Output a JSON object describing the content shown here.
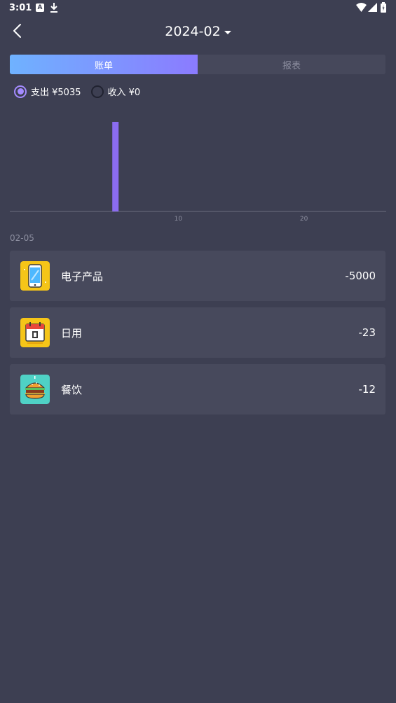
{
  "status_bar": {
    "time": "3:01",
    "a_glyph": "A"
  },
  "header": {
    "month": "2024-02"
  },
  "tabs": [
    {
      "label": "账单",
      "active": true
    },
    {
      "label": "报表",
      "active": false
    }
  ],
  "filters": {
    "expense": {
      "label": "支出 ¥5035",
      "selected": true
    },
    "income": {
      "label": "收入 ¥0",
      "selected": false
    }
  },
  "chart_data": {
    "type": "bar",
    "x_ticks": [
      10,
      20
    ],
    "x_range": [
      1,
      29
    ],
    "bars": [
      {
        "day": 5,
        "value": 5035
      }
    ],
    "color": "#8b6cf0"
  },
  "date_group": "02-05",
  "transactions": [
    {
      "name": "电子产品",
      "amount": "-5000",
      "icon": "smartphone-icon",
      "icon_bg": "#f5c518"
    },
    {
      "name": "日用",
      "amount": "-23",
      "icon": "calendar-icon",
      "icon_bg": "#f5c518"
    },
    {
      "name": "餐饮",
      "amount": "-12",
      "icon": "burger-icon",
      "icon_bg": "#4fd1c5"
    }
  ],
  "colors": {
    "background": "#3d3f52",
    "card": "#47495c",
    "accent": "#a48bff"
  }
}
